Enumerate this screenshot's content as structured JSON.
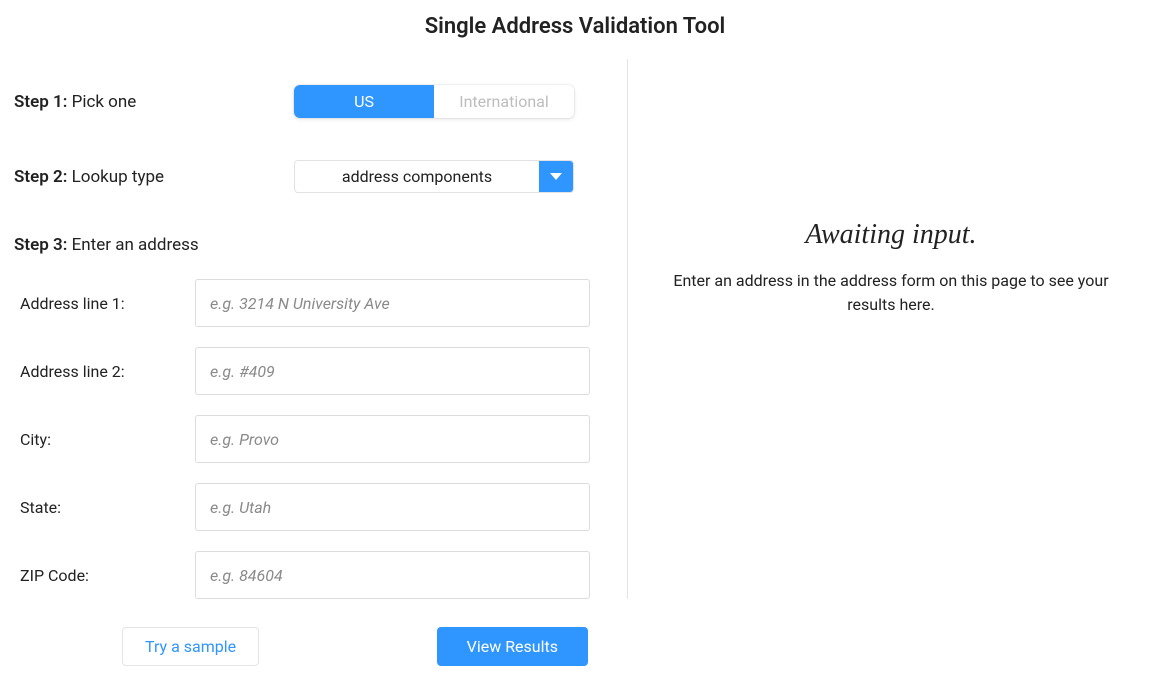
{
  "title": "Single Address Validation Tool",
  "step1": {
    "prefix": "Step 1:",
    "label": "Pick one",
    "option_us": "US",
    "option_intl": "International"
  },
  "step2": {
    "prefix": "Step 2:",
    "label": "Lookup type",
    "selected": "address components"
  },
  "step3": {
    "prefix": "Step 3:",
    "label": "Enter an address"
  },
  "fields": {
    "address1": {
      "label": "Address line 1:",
      "placeholder": "e.g. 3214 N University Ave",
      "value": ""
    },
    "address2": {
      "label": "Address line 2:",
      "placeholder": "e.g. #409",
      "value": ""
    },
    "city": {
      "label": "City:",
      "placeholder": "e.g. Provo",
      "value": ""
    },
    "state": {
      "label": "State:",
      "placeholder": "e.g. Utah",
      "value": ""
    },
    "zip": {
      "label": "ZIP Code:",
      "placeholder": "e.g. 84604",
      "value": ""
    }
  },
  "buttons": {
    "try_sample": "Try a sample",
    "view_results": "View Results"
  },
  "results": {
    "heading": "Awaiting input.",
    "sub": "Enter an address in the address form on this page to see your results here."
  }
}
